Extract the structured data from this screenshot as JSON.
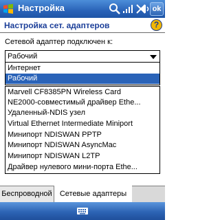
{
  "app": {
    "title": "Настройка"
  },
  "titlebar": {
    "ok_label": "ok",
    "icons": [
      "search-icon",
      "signal-icon",
      "no-connection-icon",
      "volume-icon"
    ]
  },
  "header": {
    "title": "Настройка сет. адаптеров",
    "help_label": "?"
  },
  "adapter": {
    "label": "Сетевой адаптер подключен к:",
    "selected": "Рабочий",
    "options": [
      "Интернет",
      "Рабочий"
    ],
    "highlighted_option": "Рабочий"
  },
  "adapters_list": [
    "Marvell CF8385PN Wireless Card",
    "NE2000-совместимый драйвер Ethe...",
    "Удаленный-NDIS узел",
    "Virtual Ethernet Intermediate Miniport",
    "Минипорт NDISWAN PPTP",
    "Минипорт NDISWAN AsyncMac",
    "Минипорт NDISWAN L2TP",
    "Драйвер нулевого мини-порта Ethe..."
  ],
  "tabs": [
    {
      "label": "Беспроводной",
      "active": false
    },
    {
      "label": "Сетевые адаптеры",
      "active": true
    }
  ],
  "colors": {
    "title_bar": "#2a63b8",
    "header_text": "#1c3f99",
    "selection": "#2a63b8"
  }
}
